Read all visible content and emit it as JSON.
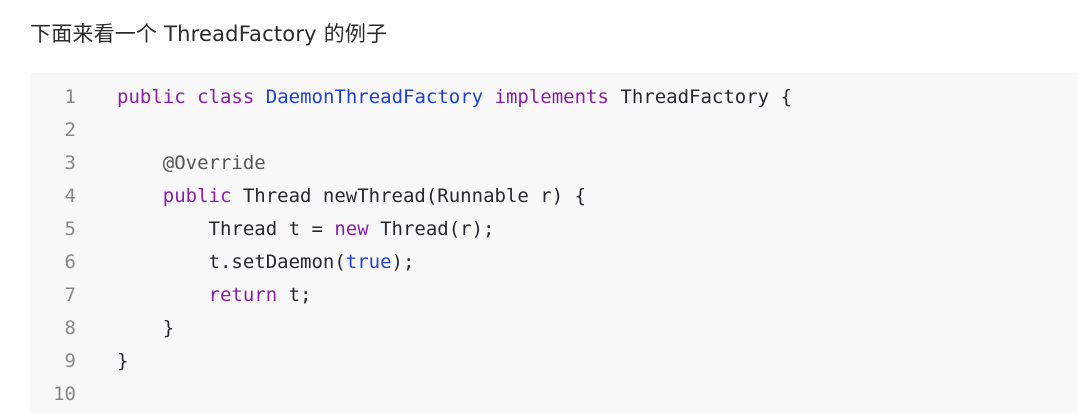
{
  "heading": "下面来看一个 ThreadFactory 的例子",
  "code": {
    "language": "java",
    "lines": [
      {
        "n": "1",
        "tokens": [
          [
            "kw",
            "public"
          ],
          [
            "p",
            " "
          ],
          [
            "kw",
            "class"
          ],
          [
            "p",
            " "
          ],
          [
            "ty",
            "DaemonThreadFactory"
          ],
          [
            "p",
            " "
          ],
          [
            "kw",
            "implements"
          ],
          [
            "p",
            " ThreadFactory {"
          ]
        ]
      },
      {
        "n": "2",
        "tokens": []
      },
      {
        "n": "3",
        "tokens": [
          [
            "p",
            "    "
          ],
          [
            "an",
            "@Override"
          ]
        ]
      },
      {
        "n": "4",
        "tokens": [
          [
            "p",
            "    "
          ],
          [
            "kw",
            "public"
          ],
          [
            "p",
            " Thread newThread(Runnable r) {"
          ]
        ]
      },
      {
        "n": "5",
        "tokens": [
          [
            "p",
            "        Thread t = "
          ],
          [
            "kw",
            "new"
          ],
          [
            "p",
            " Thread(r);"
          ]
        ]
      },
      {
        "n": "6",
        "tokens": [
          [
            "p",
            "        t.setDaemon("
          ],
          [
            "lit",
            "true"
          ],
          [
            "p",
            ");"
          ]
        ]
      },
      {
        "n": "7",
        "tokens": [
          [
            "p",
            "        "
          ],
          [
            "kw",
            "return"
          ],
          [
            "p",
            " t;"
          ]
        ]
      },
      {
        "n": "8",
        "tokens": [
          [
            "p",
            "    }"
          ]
        ]
      },
      {
        "n": "9",
        "tokens": [
          [
            "p",
            "}"
          ]
        ]
      },
      {
        "n": "10",
        "tokens": []
      }
    ]
  }
}
